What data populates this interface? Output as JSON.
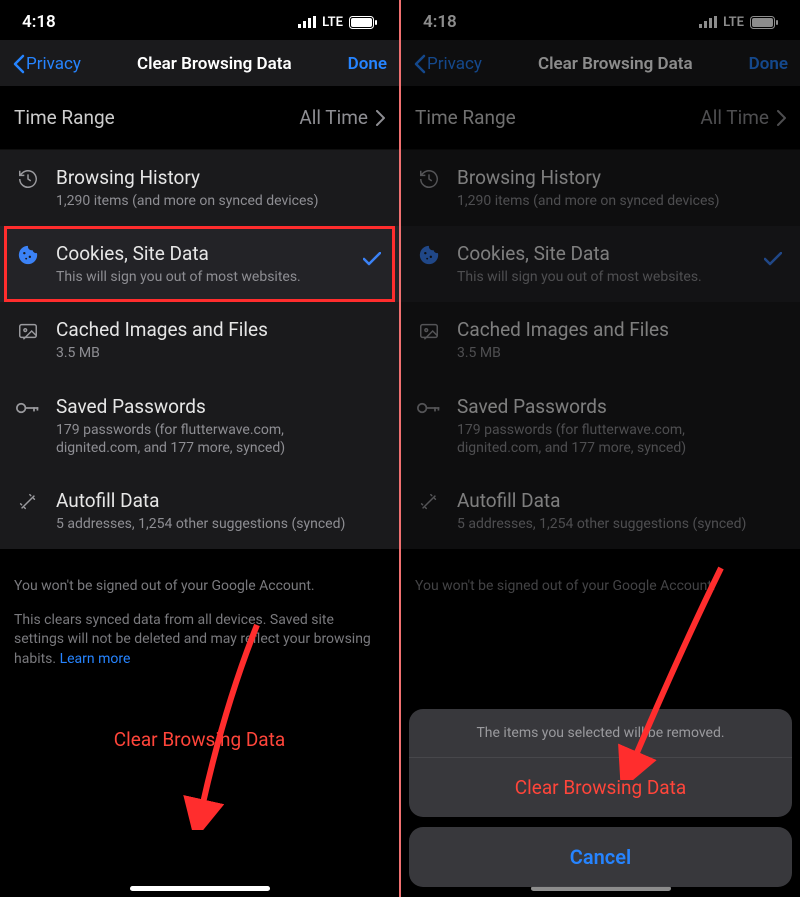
{
  "status": {
    "time": "4:18",
    "network": "LTE"
  },
  "nav": {
    "back": "Privacy",
    "title": "Clear Browsing Data",
    "done": "Done"
  },
  "time_range": {
    "label": "Time Range",
    "value": "All Time"
  },
  "items": {
    "history": {
      "title": "Browsing History",
      "sub": "1,290 items (and more on synced devices)"
    },
    "cookies": {
      "title": "Cookies, Site Data",
      "sub": "This will sign you out of most websites."
    },
    "cache": {
      "title": "Cached Images and Files",
      "sub": "3.5 MB"
    },
    "passwords": {
      "title": "Saved Passwords",
      "sub": "179 passwords (for flutterwave.com, dignited.com, and 177 more, synced)"
    },
    "autofill": {
      "title": "Autofill Data",
      "sub": "5 addresses, 1,254 other suggestions (synced)"
    }
  },
  "foot": {
    "line1": "You won't be signed out of your Google Account.",
    "line2": "This clears synced data from all devices. Saved site settings will not be deleted and may reflect your browsing habits. ",
    "learn_more": "Learn more"
  },
  "action_label": "Clear Browsing Data",
  "sheet": {
    "message": "The items you selected will be removed.",
    "confirm": "Clear Browsing Data",
    "cancel": "Cancel"
  }
}
